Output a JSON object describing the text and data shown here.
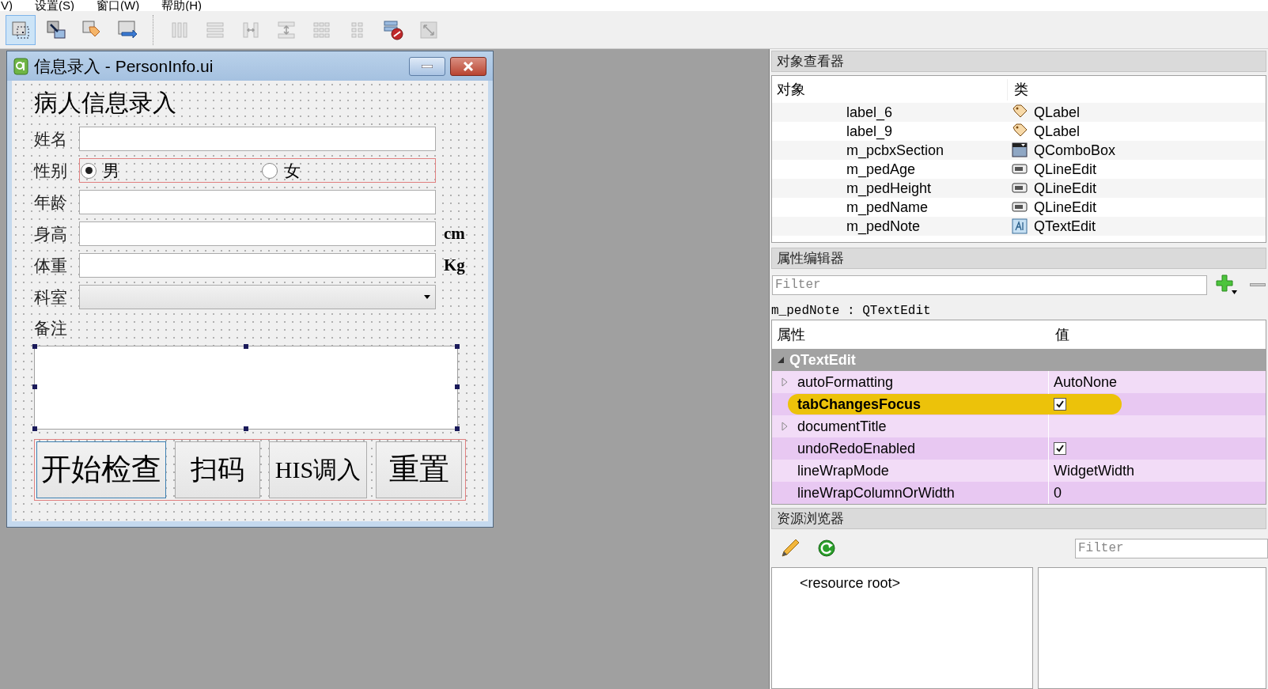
{
  "menu_bar": [
    "V)",
    "设置(S)",
    "窗口(W)",
    "帮助(H)"
  ],
  "toolbar": [
    {
      "kind": "edit-widgets",
      "selected": true,
      "disabled": false
    },
    {
      "kind": "edit-signals",
      "selected": false,
      "disabled": false
    },
    {
      "kind": "edit-buddies",
      "selected": false,
      "disabled": false
    },
    {
      "kind": "edit-tab-order",
      "selected": false,
      "disabled": false
    },
    {
      "kind": "separator"
    },
    {
      "kind": "layout-horizontal",
      "selected": false,
      "disabled": true
    },
    {
      "kind": "layout-vertical",
      "selected": false,
      "disabled": true
    },
    {
      "kind": "layout-h-splitter",
      "selected": false,
      "disabled": true
    },
    {
      "kind": "layout-v-splitter",
      "selected": false,
      "disabled": true
    },
    {
      "kind": "layout-grid",
      "selected": false,
      "disabled": true
    },
    {
      "kind": "layout-form",
      "selected": false,
      "disabled": true
    },
    {
      "kind": "break-layout",
      "selected": false,
      "disabled": false
    },
    {
      "kind": "adjust-size",
      "selected": false,
      "disabled": true
    }
  ],
  "form_window": {
    "title": "信息录入 - PersonInfo.ui",
    "heading": "病人信息录入",
    "fields": [
      {
        "label": "姓名",
        "kind": "line_edit"
      },
      {
        "label": "性别",
        "kind": "radio_group",
        "options": [
          {
            "label": "男",
            "selected": true
          },
          {
            "label": "女",
            "selected": false
          }
        ]
      },
      {
        "label": "年龄",
        "kind": "line_edit"
      },
      {
        "label": "身高",
        "kind": "line_edit",
        "unit": "cm"
      },
      {
        "label": "体重",
        "kind": "line_edit",
        "unit": "Kg"
      },
      {
        "label": "科室",
        "kind": "combo_box"
      }
    ],
    "note_label": "备注",
    "buttons": [
      {
        "label": "开始检查",
        "focused": true
      },
      {
        "label": "扫码",
        "focused": false
      },
      {
        "label": "HIS调入",
        "focused": false
      },
      {
        "label": "重置",
        "focused": false
      }
    ]
  },
  "object_inspector": {
    "title": "对象查看器",
    "columns": [
      "对象",
      "类"
    ],
    "rows": [
      {
        "object": "label_6",
        "class": "QLabel",
        "kind": "label"
      },
      {
        "object": "label_9",
        "class": "QLabel",
        "kind": "label"
      },
      {
        "object": "m_pcbxSection",
        "class": "QComboBox",
        "kind": "combo"
      },
      {
        "object": "m_pedAge",
        "class": "QLineEdit",
        "kind": "line_edit"
      },
      {
        "object": "m_pedHeight",
        "class": "QLineEdit",
        "kind": "line_edit"
      },
      {
        "object": "m_pedName",
        "class": "QLineEdit",
        "kind": "line_edit"
      },
      {
        "object": "m_pedNote",
        "class": "QTextEdit",
        "kind": "text_edit"
      }
    ]
  },
  "property_editor": {
    "title": "属性编辑器",
    "filter": {
      "placeholder": "Filter"
    },
    "object_class": "m_pedNote : QTextEdit",
    "columns": [
      "属性",
      "值"
    ],
    "group": {
      "name": "QTextEdit",
      "expanded": true
    },
    "rows": [
      {
        "property": "autoFormatting",
        "kind": "text",
        "value": "AutoNone",
        "expandable": true,
        "modified": false,
        "highlighted": false
      },
      {
        "property": "tabChangesFocus",
        "kind": "checkbox",
        "checked": true,
        "expandable": false,
        "modified": true,
        "highlighted": true
      },
      {
        "property": "documentTitle",
        "kind": "text",
        "value": "",
        "expandable": true,
        "modified": false,
        "highlighted": false
      },
      {
        "property": "undoRedoEnabled",
        "kind": "checkbox",
        "checked": true,
        "expandable": false,
        "modified": false,
        "highlighted": false
      },
      {
        "property": "lineWrapMode",
        "kind": "text",
        "value": "WidgetWidth",
        "expandable": false,
        "modified": false,
        "highlighted": false
      },
      {
        "property": "lineWrapColumnOrWidth",
        "kind": "text",
        "value": "0",
        "expandable": false,
        "modified": false,
        "highlighted": false
      }
    ]
  },
  "resource_browser": {
    "title": "资源浏览器",
    "filter": {
      "placeholder": "Filter"
    },
    "tree": [
      {
        "label": "<resource root>"
      }
    ]
  }
}
